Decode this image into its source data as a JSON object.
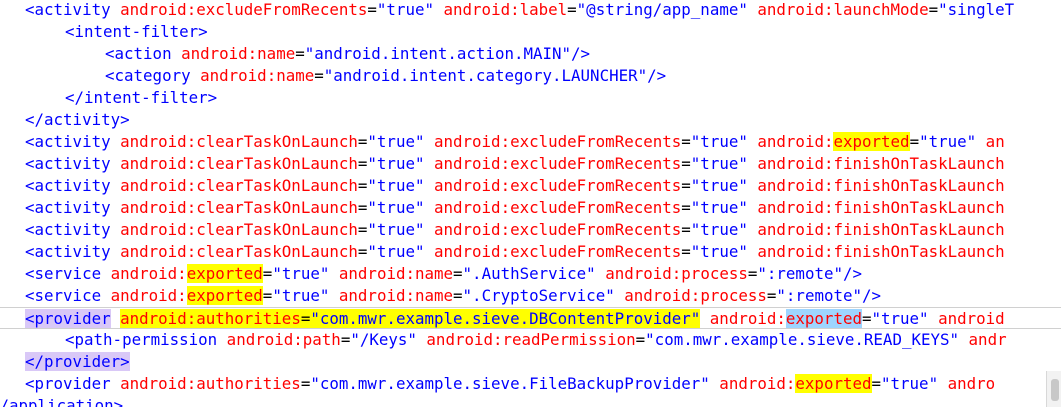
{
  "colors": {
    "tag": "#0000ff",
    "attribute": "#ff0000",
    "value": "#0000ff",
    "search_highlight": "#ffff00",
    "selected_tag_highlight": "#d9c8f7",
    "selected_word_highlight": "#9ed5ff"
  },
  "lines": [
    {
      "indent": 1,
      "tokens": [
        {
          "t": "tag",
          "v": "<activity"
        },
        {
          "t": "attr",
          "v": " android:excludeFromRecents"
        },
        {
          "t": "eq",
          "v": "="
        },
        {
          "t": "val",
          "v": "\"true\""
        },
        {
          "t": "attr",
          "v": " android:label"
        },
        {
          "t": "eq",
          "v": "="
        },
        {
          "t": "val",
          "v": "\"@string/app_name\""
        },
        {
          "t": "attr",
          "v": " android:launchMode"
        },
        {
          "t": "eq",
          "v": "="
        },
        {
          "t": "val",
          "v": "\"singleT"
        }
      ]
    },
    {
      "indent": 2,
      "tokens": [
        {
          "t": "tag",
          "v": "<intent-filter>"
        }
      ]
    },
    {
      "indent": 3,
      "tokens": [
        {
          "t": "tag",
          "v": "<action"
        },
        {
          "t": "attr",
          "v": " android:name"
        },
        {
          "t": "eq",
          "v": "="
        },
        {
          "t": "val",
          "v": "\"android.intent.action.MAIN\""
        },
        {
          "t": "tag",
          "v": "/>"
        }
      ]
    },
    {
      "indent": 3,
      "tokens": [
        {
          "t": "tag",
          "v": "<category"
        },
        {
          "t": "attr",
          "v": " android:name"
        },
        {
          "t": "eq",
          "v": "="
        },
        {
          "t": "val",
          "v": "\"android.intent.category.LAUNCHER\""
        },
        {
          "t": "tag",
          "v": "/>"
        }
      ]
    },
    {
      "indent": 2,
      "tokens": [
        {
          "t": "tag",
          "v": "</intent-filter>"
        }
      ]
    },
    {
      "indent": 1,
      "tokens": [
        {
          "t": "tag",
          "v": "</activity>"
        }
      ]
    },
    {
      "indent": 1,
      "tokens": [
        {
          "t": "tag",
          "v": "<activity"
        },
        {
          "t": "attr",
          "v": " android:clearTaskOnLaunch"
        },
        {
          "t": "eq",
          "v": "="
        },
        {
          "t": "val",
          "v": "\"true\""
        },
        {
          "t": "attr",
          "v": " android:excludeFromRecents"
        },
        {
          "t": "eq",
          "v": "="
        },
        {
          "t": "val",
          "v": "\"true\""
        },
        {
          "t": "attr",
          "v": " android:"
        },
        {
          "t": "attr",
          "v": "exported",
          "hl": "yellow"
        },
        {
          "t": "eq",
          "v": "="
        },
        {
          "t": "val",
          "v": "\"true\""
        },
        {
          "t": "attr",
          "v": " an"
        }
      ]
    },
    {
      "indent": 1,
      "tokens": [
        {
          "t": "tag",
          "v": "<activity"
        },
        {
          "t": "attr",
          "v": " android:clearTaskOnLaunch"
        },
        {
          "t": "eq",
          "v": "="
        },
        {
          "t": "val",
          "v": "\"true\""
        },
        {
          "t": "attr",
          "v": " android:excludeFromRecents"
        },
        {
          "t": "eq",
          "v": "="
        },
        {
          "t": "val",
          "v": "\"true\""
        },
        {
          "t": "attr",
          "v": " android:finishOnTaskLaunch"
        }
      ]
    },
    {
      "indent": 1,
      "tokens": [
        {
          "t": "tag",
          "v": "<activity"
        },
        {
          "t": "attr",
          "v": " android:clearTaskOnLaunch"
        },
        {
          "t": "eq",
          "v": "="
        },
        {
          "t": "val",
          "v": "\"true\""
        },
        {
          "t": "attr",
          "v": " android:excludeFromRecents"
        },
        {
          "t": "eq",
          "v": "="
        },
        {
          "t": "val",
          "v": "\"true\""
        },
        {
          "t": "attr",
          "v": " android:finishOnTaskLaunch"
        }
      ]
    },
    {
      "indent": 1,
      "tokens": [
        {
          "t": "tag",
          "v": "<activity"
        },
        {
          "t": "attr",
          "v": " android:clearTaskOnLaunch"
        },
        {
          "t": "eq",
          "v": "="
        },
        {
          "t": "val",
          "v": "\"true\""
        },
        {
          "t": "attr",
          "v": " android:excludeFromRecents"
        },
        {
          "t": "eq",
          "v": "="
        },
        {
          "t": "val",
          "v": "\"true\""
        },
        {
          "t": "attr",
          "v": " android:finishOnTaskLaunch"
        }
      ]
    },
    {
      "indent": 1,
      "tokens": [
        {
          "t": "tag",
          "v": "<activity"
        },
        {
          "t": "attr",
          "v": " android:clearTaskOnLaunch"
        },
        {
          "t": "eq",
          "v": "="
        },
        {
          "t": "val",
          "v": "\"true\""
        },
        {
          "t": "attr",
          "v": " android:excludeFromRecents"
        },
        {
          "t": "eq",
          "v": "="
        },
        {
          "t": "val",
          "v": "\"true\""
        },
        {
          "t": "attr",
          "v": " android:finishOnTaskLaunch"
        }
      ]
    },
    {
      "indent": 1,
      "tokens": [
        {
          "t": "tag",
          "v": "<activity"
        },
        {
          "t": "attr",
          "v": " android:clearTaskOnLaunch"
        },
        {
          "t": "eq",
          "v": "="
        },
        {
          "t": "val",
          "v": "\"true\""
        },
        {
          "t": "attr",
          "v": " android:excludeFromRecents"
        },
        {
          "t": "eq",
          "v": "="
        },
        {
          "t": "val",
          "v": "\"true\""
        },
        {
          "t": "attr",
          "v": " android:finishOnTaskLaunch"
        }
      ]
    },
    {
      "indent": 1,
      "tokens": [
        {
          "t": "tag",
          "v": "<service"
        },
        {
          "t": "attr",
          "v": " android:"
        },
        {
          "t": "attr",
          "v": "exported",
          "hl": "yellow"
        },
        {
          "t": "eq",
          "v": "="
        },
        {
          "t": "val",
          "v": "\"true\""
        },
        {
          "t": "attr",
          "v": " android:name"
        },
        {
          "t": "eq",
          "v": "="
        },
        {
          "t": "val",
          "v": "\".AuthService\""
        },
        {
          "t": "attr",
          "v": " android:process"
        },
        {
          "t": "eq",
          "v": "="
        },
        {
          "t": "val",
          "v": "\":remote\""
        },
        {
          "t": "tag",
          "v": "/>"
        }
      ]
    },
    {
      "indent": 1,
      "tokens": [
        {
          "t": "tag",
          "v": "<service"
        },
        {
          "t": "attr",
          "v": " android:"
        },
        {
          "t": "attr",
          "v": "exported",
          "hl": "yellow"
        },
        {
          "t": "eq",
          "v": "="
        },
        {
          "t": "val",
          "v": "\"true\""
        },
        {
          "t": "attr",
          "v": " android:name"
        },
        {
          "t": "eq",
          "v": "="
        },
        {
          "t": "val",
          "v": "\".CryptoService\""
        },
        {
          "t": "attr",
          "v": " android:process"
        },
        {
          "t": "eq",
          "v": "="
        },
        {
          "t": "val",
          "v": "\":remote\""
        },
        {
          "t": "tag",
          "v": "/>"
        }
      ]
    },
    {
      "indent": 1,
      "current": true,
      "tokens": [
        {
          "t": "tag",
          "v": "<provider",
          "hl": "purple"
        },
        {
          "t": "ws",
          "v": " "
        },
        {
          "t": "attr",
          "v": "android:authorities",
          "hl": "yellow"
        },
        {
          "t": "eq",
          "v": "=",
          "hl": "yellow"
        },
        {
          "t": "val",
          "v": "\"com.mwr.example.sieve.DBContentProvider\"",
          "hl": "yellow"
        },
        {
          "t": "attr",
          "v": " android:"
        },
        {
          "t": "attr",
          "v": "exported",
          "hl": "cyan"
        },
        {
          "t": "eq",
          "v": "="
        },
        {
          "t": "val",
          "v": "\"true\""
        },
        {
          "t": "attr",
          "v": " android"
        }
      ]
    },
    {
      "indent": 2,
      "tokens": [
        {
          "t": "tag",
          "v": "<path-permission"
        },
        {
          "t": "attr",
          "v": " android:path"
        },
        {
          "t": "eq",
          "v": "="
        },
        {
          "t": "val",
          "v": "\"/Keys\""
        },
        {
          "t": "attr",
          "v": " android:readPermission"
        },
        {
          "t": "eq",
          "v": "="
        },
        {
          "t": "val",
          "v": "\"com.mwr.example.sieve.READ_KEYS\""
        },
        {
          "t": "attr",
          "v": " andr"
        }
      ]
    },
    {
      "indent": 1,
      "tokens": [
        {
          "t": "tag",
          "v": "</provider>",
          "hl": "purple"
        }
      ]
    },
    {
      "indent": 1,
      "tokens": [
        {
          "t": "tag",
          "v": "<provider"
        },
        {
          "t": "attr",
          "v": " android:authorities"
        },
        {
          "t": "eq",
          "v": "="
        },
        {
          "t": "val",
          "v": "\"com.mwr.example.sieve.FileBackupProvider\""
        },
        {
          "t": "attr",
          "v": " android:"
        },
        {
          "t": "attr",
          "v": "exported",
          "hl": "yellow"
        },
        {
          "t": "eq",
          "v": "="
        },
        {
          "t": "val",
          "v": "\"true\""
        },
        {
          "t": "attr",
          "v": " andro"
        }
      ]
    },
    {
      "indent": 0,
      "tokens": [
        {
          "t": "tag",
          "v": "</application>"
        }
      ]
    }
  ]
}
